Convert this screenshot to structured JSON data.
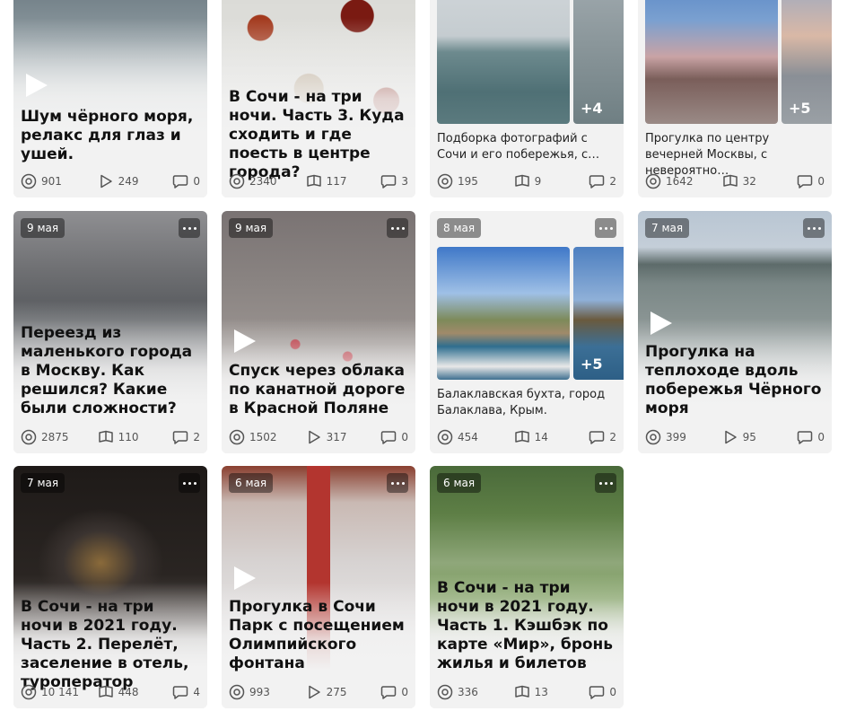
{
  "cards": [
    {
      "title": "Шум чёрного моря, релакс для глаз и ушей.",
      "views": "901",
      "plays": "249",
      "comments": "0"
    },
    {
      "title": "В Сочи - на три ночи. Часть 3. Куда сходить и где поесть в центре города?",
      "views": "2340",
      "reads": "117",
      "comments": "3"
    },
    {
      "description": "Подборка фотографий с Сочи и его побережья, с…",
      "more_photos": "+4",
      "views": "195",
      "reads": "9",
      "comments": "2"
    },
    {
      "description": "Прогулка по центру вечерней Москвы, с невероятно…",
      "more_photos": "+5",
      "views": "1642",
      "reads": "32",
      "comments": "0"
    },
    {
      "date": "9 мая",
      "title": "Переезд из маленького города в Москву. Как решился? Какие были сложности?",
      "views": "2875",
      "reads": "110",
      "comments": "2"
    },
    {
      "date": "9 мая",
      "title": "Спуск через облака по канатной дороге в Красной Поляне",
      "views": "1502",
      "plays": "317",
      "comments": "0"
    },
    {
      "date": "8 мая",
      "description": "Балаклавская бухта, город Балаклава, Крым.",
      "more_photos": "+5",
      "views": "454",
      "reads": "14",
      "comments": "2"
    },
    {
      "date": "7 мая",
      "title": "Прогулка на теплоходе вдоль побережья Чёрного моря",
      "views": "399",
      "plays": "95",
      "comments": "0"
    },
    {
      "date": "7 мая",
      "title": "В Сочи - на три ночи в 2021 году. Часть 2. Перелёт, заселение в отель, туроператор",
      "views": "10 141",
      "reads": "448",
      "comments": "4"
    },
    {
      "date": "6 мая",
      "title": "Прогулка в Сочи Парк с посещением Олимпийского фонтана",
      "views": "993",
      "plays": "275",
      "comments": "0"
    },
    {
      "date": "6 мая",
      "title": "В Сочи - на три ночи в 2021 году. Часть 1. Кэшбэк по карте «Мир», бронь жилья и билетов",
      "views": "336",
      "reads": "13",
      "comments": "0"
    }
  ],
  "icons": {
    "views": "eye-circle-icon",
    "plays": "play-outline-icon",
    "reads": "open-book-icon",
    "comments": "comment-bubble-icon",
    "video": "play-triangle-icon",
    "menu": "more-dots-icon"
  },
  "colors": {
    "card_background": "#f2f2f2",
    "title_text": "#111111",
    "stats_text": "#555555"
  }
}
